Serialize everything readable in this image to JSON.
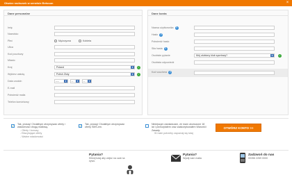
{
  "window": {
    "title": "Otwórz rachunek w serwisie Betsson",
    "close_label": "×"
  },
  "personal": {
    "heading": "Dane personalne",
    "fields": [
      {
        "label": "Imię",
        "value": ""
      },
      {
        "label": "Nazwisko",
        "value": ""
      },
      {
        "label": "Płeć",
        "type": "radio",
        "options": [
          "Mężczyzna",
          "Kobieta"
        ]
      },
      {
        "label": "Ulica",
        "value": ""
      },
      {
        "label": "Kod pocztowy",
        "value": ""
      },
      {
        "label": "Miasto",
        "value": ""
      },
      {
        "label": "Kraj",
        "value": "Poland",
        "type": "select"
      },
      {
        "label": "Wybierz walutę",
        "value": "Polish Złoty",
        "type": "select"
      },
      {
        "label": "Data urodzin",
        "type": "date",
        "parts": [
          "----",
          "--",
          "--"
        ]
      },
      {
        "label": "E-mail",
        "value": ""
      },
      {
        "label": "Potwierdź maila",
        "value": ""
      },
      {
        "label": "Telefon komórkowy",
        "value": ""
      }
    ]
  },
  "account": {
    "heading": "Dane konta",
    "fields": [
      {
        "label": "Nazwa użytkownika",
        "value": ""
      },
      {
        "label": "Hasło",
        "value": ""
      },
      {
        "label": "Potwierdź hasło",
        "value": ""
      },
      {
        "label": "Siła hasła",
        "value": ""
      },
      {
        "label": "Osobiste pytanie",
        "value": "Mój ulubiony klub sportowy?",
        "type": "select"
      },
      {
        "label": "Osobista odpowiedź",
        "value": ""
      },
      {
        "label": "Kod vouchera",
        "value": ""
      }
    ]
  },
  "consents": [
    {
      "text": "Tak, proszę! Chciałbym otrzymywać oferty i wiadomości drogą mailową.",
      "sub": [
        "- Oferty i bonusy",
        "- Ekscytujące oferty",
        "- Ważne wiadomości"
      ]
    },
    {
      "text": "Tak, proszę! Chciałbym otrzymywać oferty SMS-em.",
      "sub": []
    },
    {
      "text": "Niniejszym oświadczam, że mam ukończone 18 lat i przeczytałem oraz zaakceptowałem Warunki i Zasady.",
      "sub": [
        "W razie potrzeby zapoznaj się tutaj"
      ]
    }
  ],
  "cta": {
    "label": "OTWÓRZ KONTO >>"
  },
  "footer": {
    "questions_title": "Pytania?",
    "questions_text": "Kliknij tutaj aby wejść na czat na żywo.",
    "mail_title": "Pytania?",
    "mail_text": "Wyślij nam maila",
    "call_title": "Zadzwoń do nas",
    "call_text": "00356 2269 0000"
  }
}
